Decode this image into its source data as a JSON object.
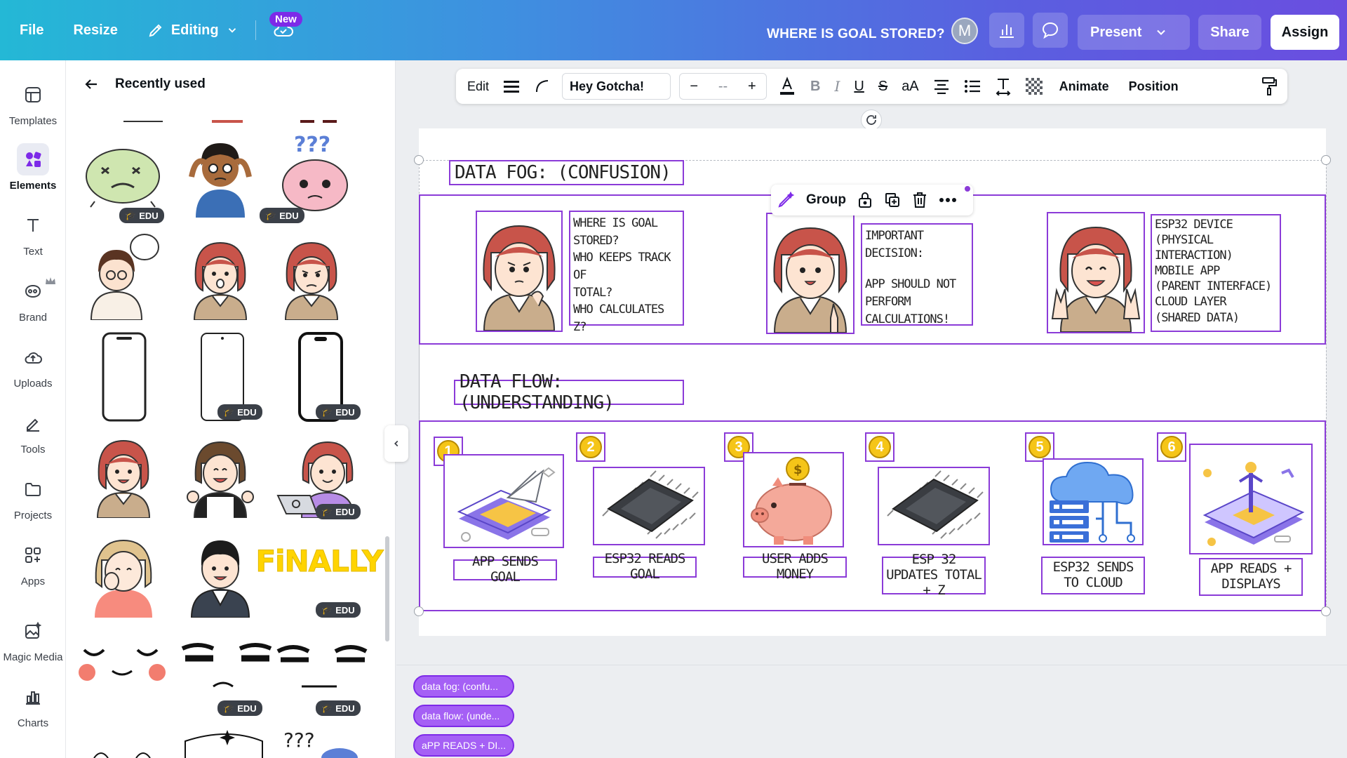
{
  "topbar": {
    "file": "File",
    "resize": "Resize",
    "editing": "Editing",
    "new_badge": "New",
    "title": "WHERE IS GOAL STORED?",
    "avatar_letter": "M",
    "present": "Present",
    "share": "Share",
    "assign": "Assign"
  },
  "rail": {
    "items": [
      {
        "label": "Templates",
        "icon": "templates-icon"
      },
      {
        "label": "Elements",
        "icon": "elements-icon"
      },
      {
        "label": "Text",
        "icon": "text-icon"
      },
      {
        "label": "Brand",
        "icon": "brand-icon"
      },
      {
        "label": "Uploads",
        "icon": "uploads-icon"
      },
      {
        "label": "Tools",
        "icon": "tools-icon"
      },
      {
        "label": "Projects",
        "icon": "projects-icon"
      },
      {
        "label": "Apps",
        "icon": "apps-icon"
      },
      {
        "label": "Magic Media",
        "icon": "magic-media-icon"
      },
      {
        "label": "Charts",
        "icon": "charts-icon"
      }
    ]
  },
  "panel": {
    "title": "Recently used",
    "edu_badge": "EDU",
    "finally_text": "FiNALLY"
  },
  "format_toolbar": {
    "edit": "Edit",
    "font": "Hey Gotcha!",
    "minus": "−",
    "size": "--",
    "plus": "+",
    "bold": "B",
    "italic": "I",
    "underline": "U",
    "strike": "S",
    "case": "aA",
    "animate": "Animate",
    "position": "Position"
  },
  "group_toolbar": {
    "group": "Group"
  },
  "canvas": {
    "fog_title": "DATA FOG: (CONFUSION)",
    "fog_note_1": [
      "WHERE IS GOAL",
      "STORED?",
      "WHO KEEPS TRACK OF",
      "TOTAL?",
      "WHO CALCULATES Z?"
    ],
    "fog_note_2": [
      "IMPORTANT DECISION:",
      "",
      "APP SHOULD NOT",
      "PERFORM",
      "CALCULATIONS!"
    ],
    "fog_note_3": [
      "ESP32 DEVICE",
      "(PHYSICAL INTERACTION)",
      "MOBILE APP",
      "(PARENT INTERFACE)",
      "CLOUD LAYER",
      "(SHARED DATA)"
    ],
    "flow_title": "DATA FLOW: (UNDERSTANDING)",
    "steps": [
      {
        "n": "1",
        "caption": "APP SENDS GOAL"
      },
      {
        "n": "2",
        "caption": "ESP32 READS GOAL"
      },
      {
        "n": "3",
        "caption": "USER ADDS MONEY"
      },
      {
        "n": "4",
        "caption": "ESP 32 UPDATES TOTAL + Z"
      },
      {
        "n": "5",
        "caption": "ESP32 SENDS TO CLOUD"
      },
      {
        "n": "6",
        "caption": "APP READS + DISPLAYS"
      }
    ]
  },
  "layers": [
    "data fog: (confu...",
    "data flow: (unde...",
    "aPP READS + DI..."
  ],
  "colors": {
    "accent": "#8b3bd8",
    "coin": "#f5c518",
    "hair": "#c8544a"
  }
}
